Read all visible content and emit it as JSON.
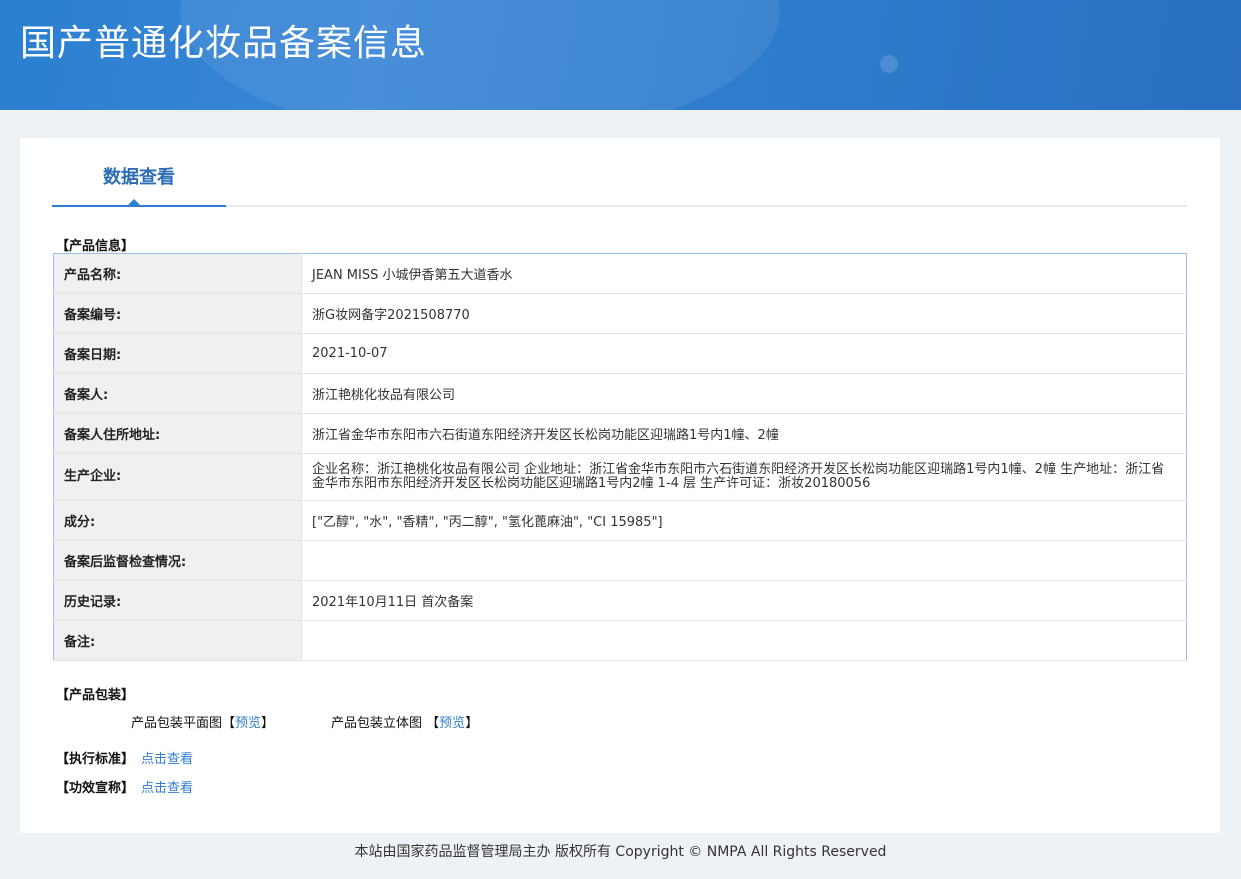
{
  "header": {
    "title": "国产普通化妆品备案信息"
  },
  "tab": {
    "label": "数据查看"
  },
  "sections": {
    "product_info": "【产品信息】",
    "packaging": "【产品包装】",
    "standard": "【执行标准】",
    "efficacy": "【功效宣称】"
  },
  "rows": [
    {
      "label": "产品名称:",
      "value": "JEAN MISS 小城伊香第五大道香水"
    },
    {
      "label": "备案编号:",
      "value": "浙G妆网备字2021508770"
    },
    {
      "label": "备案日期:",
      "value": "2021-10-07"
    },
    {
      "label": "备案人:",
      "value": "浙江艳桃化妆品有限公司"
    },
    {
      "label": "备案人住所地址:",
      "value": "浙江省金华市东阳市六石街道东阳经济开发区长松岗功能区迎瑞路1号内1幢、2幢"
    },
    {
      "label": "生产企业:",
      "value": "企业名称：浙江艳桃化妆品有限公司 企业地址：浙江省金华市东阳市六石街道东阳经济开发区长松岗功能区迎瑞路1号内1幢、2幢 生产地址：浙江省金华市东阳市东阳经济开发区长松岗功能区迎瑞路1号内2幢 1-4 层 生产许可证：浙妆20180056"
    },
    {
      "label": "成分:",
      "value": "[\"乙醇\", \"水\", \"香精\", \"丙二醇\", \"氢化蓖麻油\", \"CI 15985\"]"
    },
    {
      "label": "备案后监督检查情况:",
      "value": ""
    },
    {
      "label": "历史记录:",
      "value": "2021年10月11日 首次备案"
    },
    {
      "label": "备注:",
      "value": ""
    }
  ],
  "packaging": {
    "flat_label": "产品包装平面图",
    "solid_label": "产品包装立体图",
    "preview": "预览",
    "open": "【",
    "close": "】"
  },
  "links": {
    "view": "点击查看"
  },
  "footer": "本站由国家药品监督管理局主办 版权所有 Copyright © NMPA All Rights Reserved"
}
